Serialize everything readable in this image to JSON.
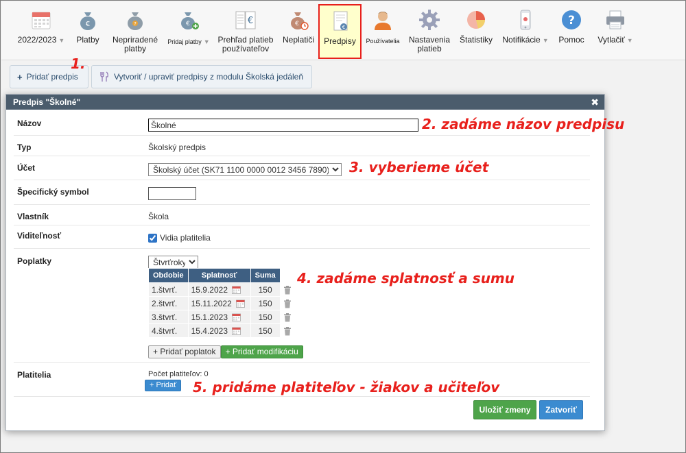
{
  "toolbar": {
    "items": [
      {
        "label": "2022/2023",
        "has_caret": true,
        "icon": "calendar-icon"
      },
      {
        "label": "Platby",
        "icon": "money-bag-euro-icon"
      },
      {
        "label": "Nepriradené\nplatby",
        "icon": "money-bag-question-icon"
      },
      {
        "label": "Pridaj platby",
        "icon": "money-bag-add-icon",
        "has_caret": true
      },
      {
        "label": "Prehľad platieb\npoužívateľov",
        "icon": "payment-overview-icon"
      },
      {
        "label": "Neplatiči",
        "icon": "money-bag-clock-icon"
      },
      {
        "label": "Predpisy",
        "icon": "document-euro-icon",
        "active": true
      },
      {
        "label": "Používatelia",
        "icon": "user-icon"
      },
      {
        "label": "Nastavenia\nplatieb",
        "icon": "gear-icon"
      },
      {
        "label": "Štatistiky",
        "icon": "pie-chart-icon"
      },
      {
        "label": "Notifikácie",
        "icon": "phone-icon",
        "has_caret": true
      },
      {
        "label": "Pomoc",
        "icon": "help-icon"
      },
      {
        "label": "Vytlačiť",
        "icon": "printer-icon",
        "has_caret": true
      }
    ],
    "active_border_color": "#e8201c"
  },
  "actions": {
    "add_rule_label": "Pridať predpis",
    "canteen_label": "Vytvoriť / upraviť predpisy z modulu Školská jedáleň"
  },
  "annotations": {
    "a1": "1.",
    "a2": "2. zadáme názov predpisu",
    "a3": "3. vyberieme účet",
    "a4": "4. zadáme splatnosť a sumu",
    "a5": "5. pridáme platiteľov - žiakov a učiteľov",
    "color": "#e8201c"
  },
  "dialog": {
    "title": "Predpis \"Školné\"",
    "close_icon": "close-icon",
    "fields": {
      "name_label": "Názov",
      "name_value": "Školné",
      "type_label": "Typ",
      "type_value": "Školský predpis",
      "account_label": "Účet",
      "account_value": "Školský účet (SK71 1100 0000 0012 3456 7890)",
      "symbol_label": "Špecifický symbol",
      "symbol_value": "",
      "owner_label": "Vlastník",
      "owner_value": "Škola",
      "visibility_label": "Viditeľnosť",
      "visibility_checkbox_label": "Vidia platitelia",
      "visibility_checked": true,
      "fees_label": "Poplatky",
      "fees_period_value": "Štvrťroky",
      "payers_label": "Platitelia",
      "payers_count_text": "Počet platiteľov: 0",
      "add_payer_label": "+ Pridať"
    },
    "fees_table": {
      "headers": [
        "Obdobie",
        "Splatnosť",
        "Suma"
      ],
      "rows": [
        {
          "period": "1.štvrť.",
          "due": "15.9.2022",
          "amount": "150"
        },
        {
          "period": "2.štvrť.",
          "due": "15.11.2022",
          "amount": "150"
        },
        {
          "period": "3.štvrť.",
          "due": "15.1.2023",
          "amount": "150"
        },
        {
          "period": "4.štvrť.",
          "due": "15.4.2023",
          "amount": "150"
        }
      ],
      "header_color": "#3e5f82"
    },
    "add_fee_label": "+ Pridať poplatok",
    "add_modification_label": "+ Pridať modifikáciu",
    "save_label": "Uložiť zmeny",
    "close_label": "Zatvoriť",
    "save_color": "#4ea44a",
    "close_color": "#3b8bd0"
  }
}
